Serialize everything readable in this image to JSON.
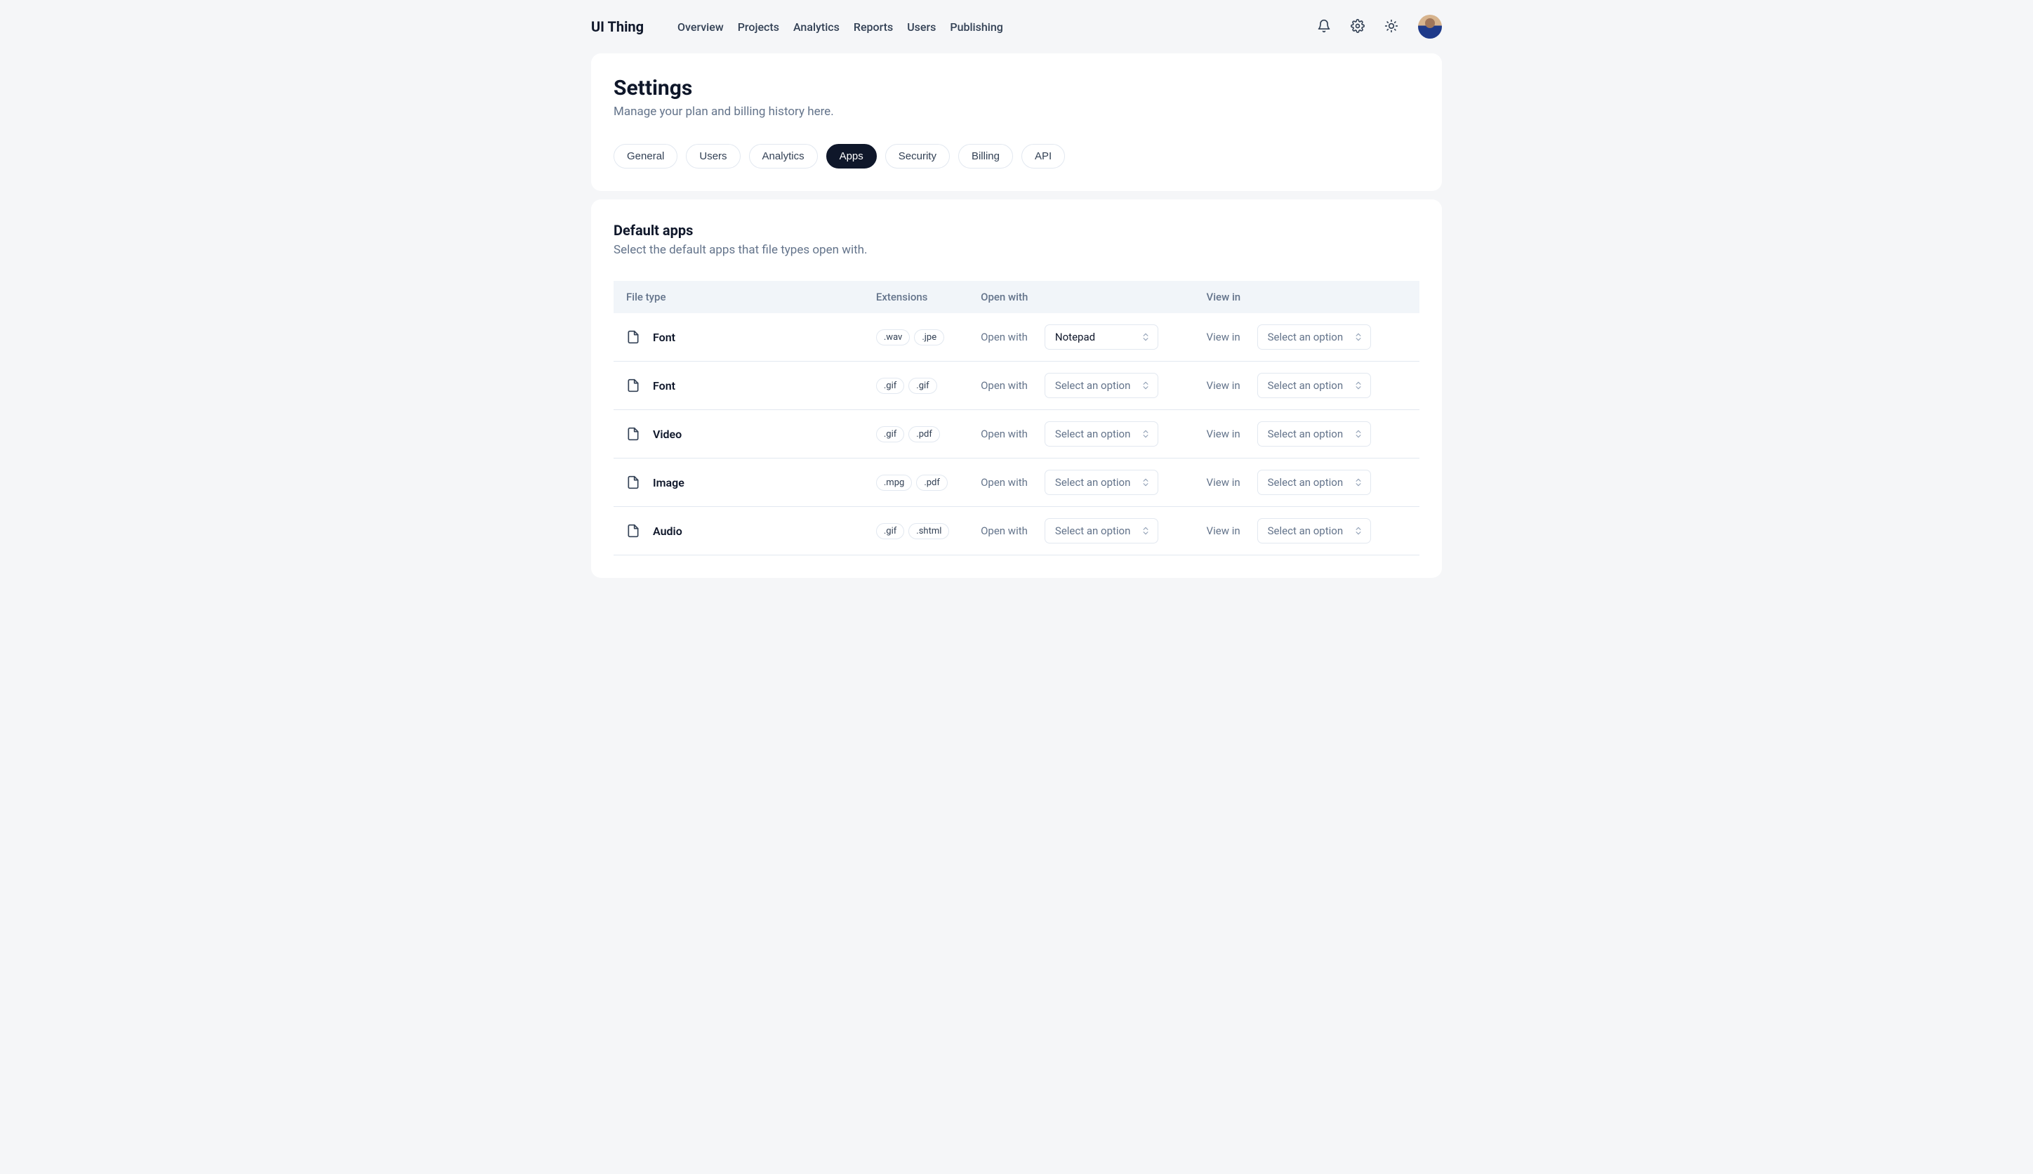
{
  "brand": "UI Thing",
  "nav": {
    "items": [
      "Overview",
      "Projects",
      "Analytics",
      "Reports",
      "Users",
      "Publishing"
    ]
  },
  "page": {
    "title": "Settings",
    "subtitle": "Manage your plan and billing history here."
  },
  "tabs": [
    "General",
    "Users",
    "Analytics",
    "Apps",
    "Security",
    "Billing",
    "API"
  ],
  "tabs_active_index": 3,
  "section": {
    "title": "Default apps",
    "subtitle": "Select the default apps that file types open with."
  },
  "table": {
    "headers": {
      "file_type": "File type",
      "extensions": "Extensions",
      "open_with": "Open with",
      "view_in": "View in"
    },
    "labels": {
      "open_with": "Open with",
      "view_in": "View in",
      "select_placeholder": "Select an option"
    },
    "rows": [
      {
        "name": "Font",
        "exts": [
          ".wav",
          ".jpe"
        ],
        "open_with": "Notepad",
        "view_in": ""
      },
      {
        "name": "Font",
        "exts": [
          ".gif",
          ".gif"
        ],
        "open_with": "",
        "view_in": ""
      },
      {
        "name": "Video",
        "exts": [
          ".gif",
          ".pdf"
        ],
        "open_with": "",
        "view_in": ""
      },
      {
        "name": "Image",
        "exts": [
          ".mpg",
          ".pdf"
        ],
        "open_with": "",
        "view_in": ""
      },
      {
        "name": "Audio",
        "exts": [
          ".gif",
          ".shtml"
        ],
        "open_with": "",
        "view_in": ""
      }
    ]
  }
}
